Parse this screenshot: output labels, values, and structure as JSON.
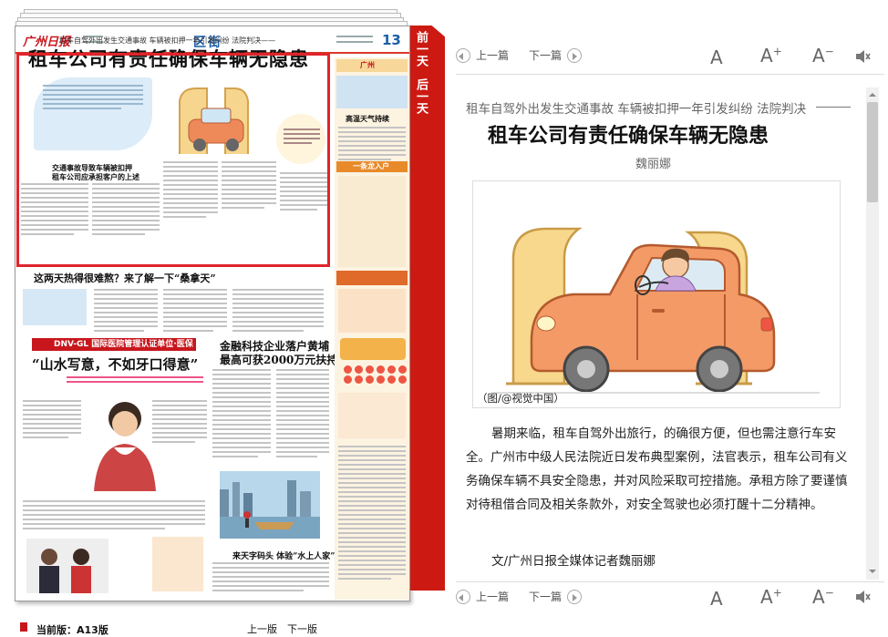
{
  "paper": {
    "logo": "广州日报",
    "section": "区街",
    "page_number": "13",
    "headline_pre": "租车自驾外出发生交通事故 车辆被扣押一年引发纠纷 法院判决——",
    "headline": "租车公司有责任确保车辆无隐患",
    "article_title_1": "交通事故导致车辆被扣押",
    "article_title_2": "租车公司应承担客户的上述",
    "heat_headline": "这两天热得很难熬？来了解一下“桑拿天”",
    "ad_band": "DNV-GL 国际医院管理认证单位·医保定点机构",
    "ad_slogan": "“山水写意，不如牙口得意”",
    "finance_headline_1": "金融科技企业落户黄埔",
    "finance_headline_2": "最高可获2000万元扶持",
    "community_headline": "来天字码头 体验“水上人家”",
    "sidebar_city": "广州",
    "sidebar_heat": "高温天气持续",
    "sidebar_lottery": "一条龙入户"
  },
  "ribbon": {
    "prev_day": "前一天",
    "next_day": "后一天"
  },
  "bottom": {
    "current_label": "当前版：",
    "current_page": "A13版",
    "prev_page": "上一版",
    "next_page": "下一版"
  },
  "toolbar": {
    "prev_article": "上一篇",
    "next_article": "下一篇",
    "font_normal": "A",
    "font_larger": "A",
    "font_smaller": "A",
    "plus": "+",
    "minus": "−"
  },
  "article": {
    "subtitle": "租车自驾外出发生交通事故 车辆被扣押一年引发纠纷 法院判决",
    "title": "租车公司有责任确保车辆无隐患",
    "author": "魏丽娜",
    "caption": "（图/@视觉中国）",
    "body": "暑期来临，租车自驾外出旅行，的确很方便，但也需注意行车安全。广州市中级人民法院近日发布典型案例，法官表示，租车公司有义务确保车辆不具安全隐患，并对风险采取可控措施。承租方除了要谨慎对待租借合同及相关条款外，对安全驾驶也必须打醒十二分精神。",
    "byline": "文/广州日报全媒体记者魏丽娜"
  },
  "colors": {
    "accent_red": "#cc1a12",
    "link_blue": "#1b5fa8"
  }
}
